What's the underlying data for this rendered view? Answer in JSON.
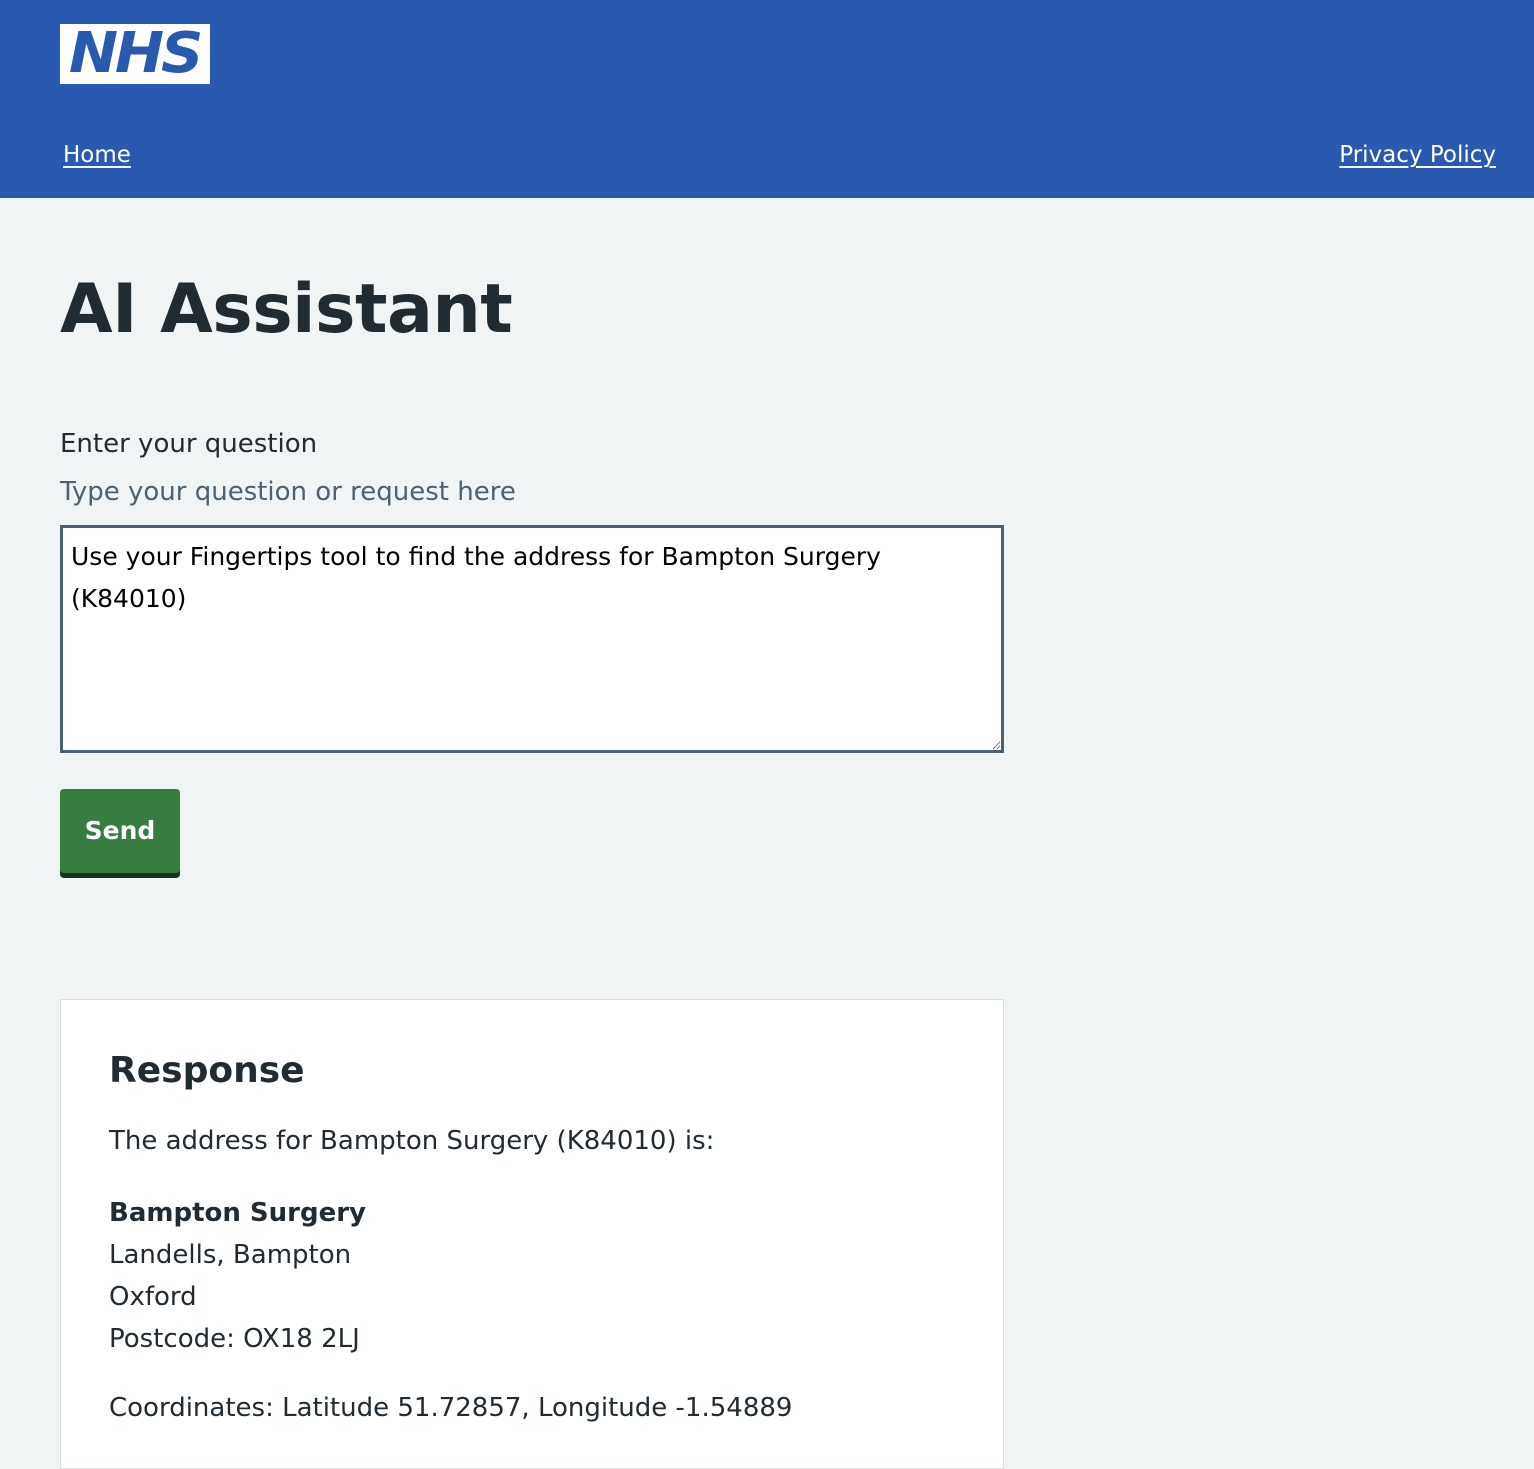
{
  "header": {
    "logo_text": "NHS",
    "brand_color": "#285bb0",
    "nav": {
      "home_label": "Home",
      "privacy_label": "Privacy Policy"
    }
  },
  "main": {
    "title": "AI Assistant",
    "form": {
      "label": "Enter your question",
      "hint": "Type your question or request here",
      "question_value": "Use your Fingertips tool to find the address for Bampton Surgery (K84010)",
      "send_label": "Send",
      "send_color": "#367d3f"
    },
    "response": {
      "heading": "Response",
      "intro": "The address for Bampton Surgery (K84010) is:",
      "address": {
        "name": "Bampton Surgery",
        "line1": "Landells, Bampton",
        "line2": "Oxford",
        "postcode": "Postcode: OX18 2LJ"
      },
      "coordinates": "Coordinates: Latitude 51.72857, Longitude -1.54889"
    }
  }
}
